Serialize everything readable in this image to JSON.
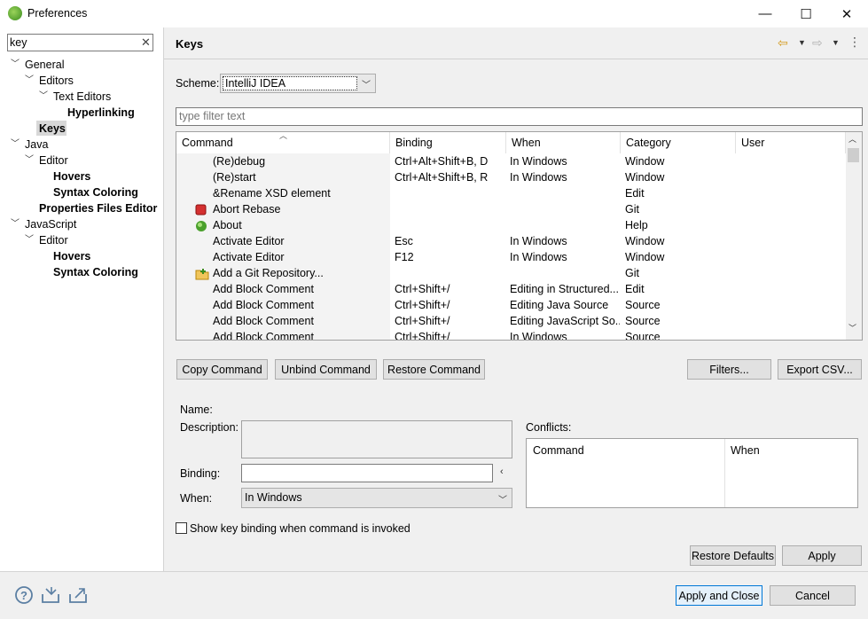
{
  "window": {
    "title": "Preferences",
    "minimize": "—",
    "maximize": "☐",
    "close": "✕"
  },
  "sidebar": {
    "filter_value": "key",
    "clear_icon": "✕",
    "tree": [
      {
        "label": "General",
        "level": 0,
        "expanded": true,
        "bold": false
      },
      {
        "label": "Editors",
        "level": 1,
        "expanded": true,
        "bold": false
      },
      {
        "label": "Text Editors",
        "level": 2,
        "expanded": true,
        "bold": false
      },
      {
        "label": "Hyperlinking",
        "level": 3,
        "expanded": false,
        "bold": true
      },
      {
        "label": "Keys",
        "level": 1,
        "expanded": false,
        "bold": true,
        "selected": true
      },
      {
        "label": "Java",
        "level": 0,
        "expanded": true,
        "bold": false
      },
      {
        "label": "Editor",
        "level": 1,
        "expanded": true,
        "bold": false
      },
      {
        "label": "Hovers",
        "level": 2,
        "expanded": false,
        "bold": true
      },
      {
        "label": "Syntax Coloring",
        "level": 2,
        "expanded": false,
        "bold": true
      },
      {
        "label": "Properties Files Editor",
        "level": 1,
        "expanded": false,
        "bold": true
      },
      {
        "label": "JavaScript",
        "level": 0,
        "expanded": true,
        "bold": false
      },
      {
        "label": "Editor",
        "level": 1,
        "expanded": true,
        "bold": false
      },
      {
        "label": "Hovers",
        "level": 2,
        "expanded": false,
        "bold": true
      },
      {
        "label": "Syntax Coloring",
        "level": 2,
        "expanded": false,
        "bold": true
      }
    ]
  },
  "page": {
    "title": "Keys",
    "scheme_label": "Scheme:",
    "scheme_value": "IntelliJ IDEA",
    "filter_placeholder": "type filter text",
    "columns": [
      "Command",
      "Binding",
      "When",
      "Category",
      "User"
    ],
    "rows": [
      {
        "icon": "",
        "command": "(Re)debug",
        "binding": "Ctrl+Alt+Shift+B, D",
        "when": "In Windows",
        "category": "Window",
        "user": ""
      },
      {
        "icon": "",
        "command": "(Re)start",
        "binding": "Ctrl+Alt+Shift+B, R",
        "when": "In Windows",
        "category": "Window",
        "user": ""
      },
      {
        "icon": "",
        "command": "&Rename XSD element",
        "binding": "",
        "when": "",
        "category": "Edit",
        "user": ""
      },
      {
        "icon": "abort-rebase-icon",
        "command": "Abort Rebase",
        "binding": "",
        "when": "",
        "category": "Git",
        "user": ""
      },
      {
        "icon": "about-icon",
        "command": "About",
        "binding": "",
        "when": "",
        "category": "Help",
        "user": ""
      },
      {
        "icon": "",
        "command": "Activate Editor",
        "binding": "Esc",
        "when": "In Windows",
        "category": "Window",
        "user": ""
      },
      {
        "icon": "",
        "command": "Activate Editor",
        "binding": "F12",
        "when": "In Windows",
        "category": "Window",
        "user": ""
      },
      {
        "icon": "git-repository-icon",
        "command": "Add a Git Repository...",
        "binding": "",
        "when": "",
        "category": "Git",
        "user": ""
      },
      {
        "icon": "",
        "command": "Add Block Comment",
        "binding": "Ctrl+Shift+/",
        "when": "Editing in Structured...",
        "category": "Edit",
        "user": ""
      },
      {
        "icon": "",
        "command": "Add Block Comment",
        "binding": "Ctrl+Shift+/",
        "when": "Editing Java Source",
        "category": "Source",
        "user": ""
      },
      {
        "icon": "",
        "command": "Add Block Comment",
        "binding": "Ctrl+Shift+/",
        "when": "Editing JavaScript So...",
        "category": "Source",
        "user": ""
      },
      {
        "icon": "",
        "command": "Add Block Comment",
        "binding": "Ctrl+Shift+/",
        "when": "In Windows",
        "category": "Source",
        "user": ""
      }
    ],
    "buttons": {
      "copy": "Copy Command",
      "unbind": "Unbind Command",
      "restore": "Restore Command",
      "filters": "Filters...",
      "export": "Export CSV..."
    },
    "details": {
      "name_label": "Name:",
      "description_label": "Description:",
      "binding_label": "Binding:",
      "binding_value": "",
      "when_label": "When:",
      "when_value": "In Windows",
      "conflicts_label": "Conflicts:",
      "conflicts_columns": [
        "Command",
        "When"
      ]
    },
    "show_keybinding_label": "Show key binding when command is invoked",
    "show_keybinding_checked": false,
    "restore_defaults": "Restore Defaults",
    "apply": "Apply"
  },
  "footer": {
    "apply_and_close": "Apply and Close",
    "cancel": "Cancel"
  }
}
